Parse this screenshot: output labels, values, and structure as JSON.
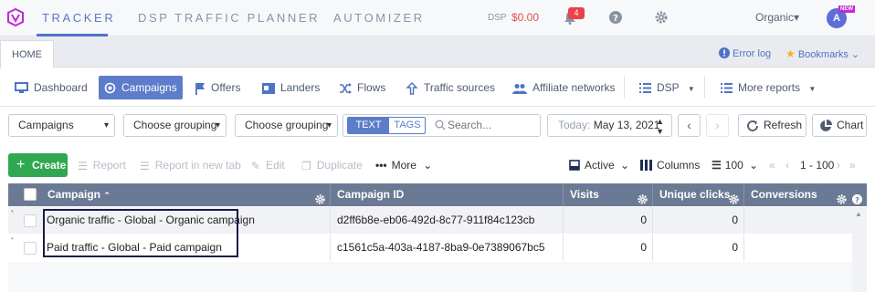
{
  "topnav": {
    "links": [
      "TRACKER",
      "DSP TRAFFIC PLANNER",
      "AUTOMIZER"
    ],
    "dsp_label": "DSP",
    "dsp_value": "$0.00",
    "notification_count": "4",
    "workspace": "Organic",
    "avatar_initial": "A",
    "new_badge": "NEW"
  },
  "tabrow": {
    "home_tab": "HOME",
    "error_log": "Error log",
    "bookmarks": "Bookmarks"
  },
  "secnav": {
    "items": [
      "Dashboard",
      "Campaigns",
      "Offers",
      "Landers",
      "Flows",
      "Traffic sources",
      "Affiliate networks",
      "DSP",
      "More reports"
    ],
    "active": "Campaigns"
  },
  "filters": {
    "entity": "Campaigns",
    "grouping1": "Choose grouping",
    "grouping2": "Choose grouping",
    "text_tab": "TEXT",
    "tags_tab": "TAGS",
    "search_placeholder": "Search...",
    "date_label": "Today:",
    "date_value": "May 13, 2021",
    "refresh": "Refresh",
    "chart": "Chart"
  },
  "actions": {
    "create": "Create",
    "report": "Report",
    "report_new_tab": "Report in new tab",
    "edit": "Edit",
    "duplicate": "Duplicate",
    "more": "More",
    "active": "Active",
    "columns": "Columns",
    "per_page": "100",
    "range": "1 - 100"
  },
  "table": {
    "headers": [
      "Campaign",
      "Campaign ID",
      "Visits",
      "Unique clicks",
      "Conversions"
    ],
    "rows": [
      {
        "campaign": "Organic traffic - Global - Organic campaign",
        "id": "d2ff6b8e-eb06-492d-8c77-911f84c123cb",
        "visits": "0",
        "unique_clicks": "0"
      },
      {
        "campaign": "Paid traffic - Global - Paid campaign",
        "id": "c1561c5a-403a-4187-8ba9-0e7389067bc5",
        "visits": "0",
        "unique_clicks": "0"
      }
    ]
  },
  "colors": {
    "accent": "#5d7cc9",
    "create": "#2fa84f",
    "header": "#6b7a94",
    "alert": "#e8424a"
  }
}
